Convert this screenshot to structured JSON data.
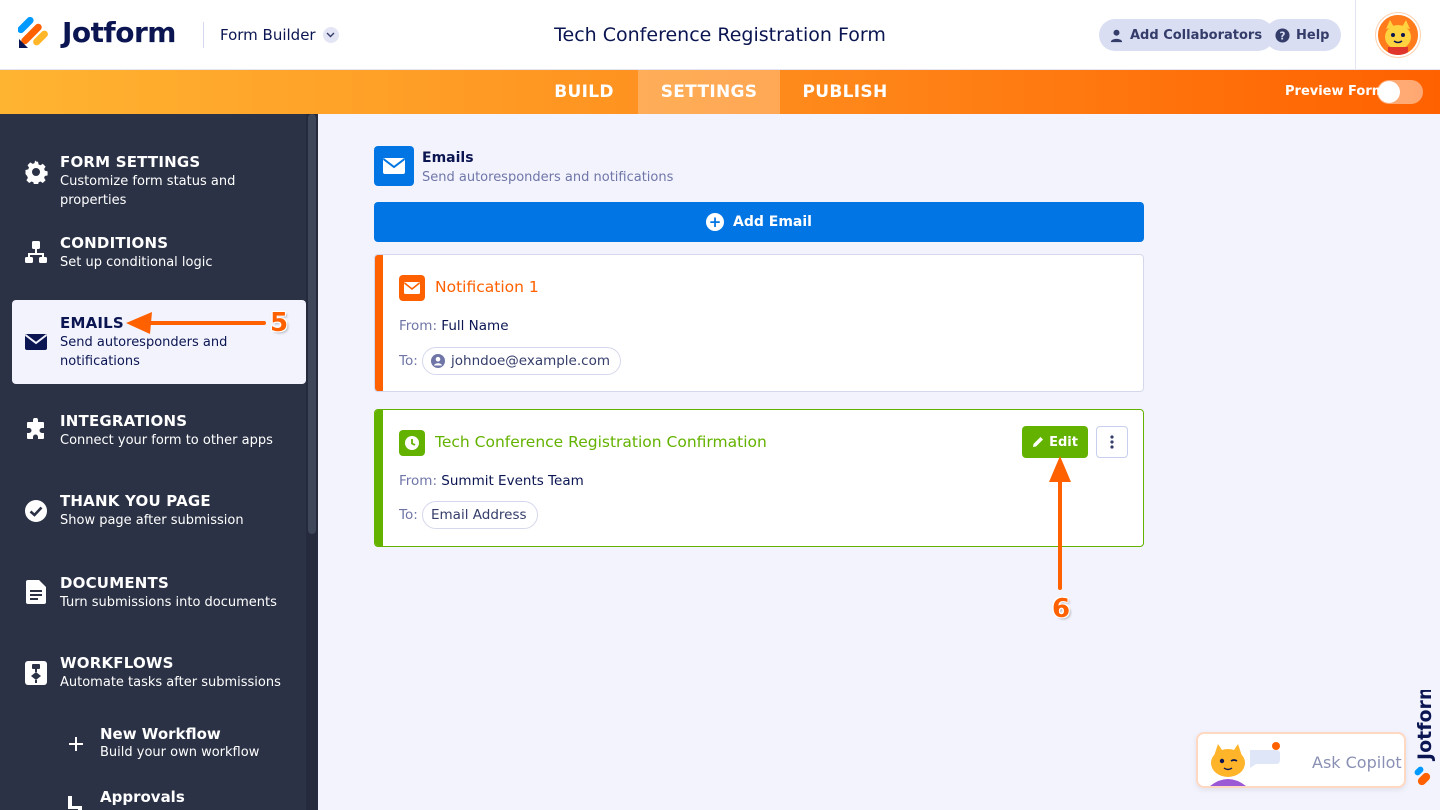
{
  "header": {
    "logo_text": "Jotform",
    "builder_select": "Form Builder",
    "form_title": "Tech Conference Registration Form",
    "add_collaborators": "Add Collaborators",
    "help": "Help"
  },
  "nav": {
    "tabs": [
      {
        "label": "BUILD",
        "active": false
      },
      {
        "label": "SETTINGS",
        "active": true
      },
      {
        "label": "PUBLISH",
        "active": false
      }
    ],
    "preview_label": "Preview Form",
    "preview_on": false
  },
  "sidebar": {
    "items": [
      {
        "title": "FORM SETTINGS",
        "desc": "Customize form status and properties",
        "icon": "gear-icon"
      },
      {
        "title": "CONDITIONS",
        "desc": "Set up conditional logic",
        "icon": "conditions-icon"
      },
      {
        "title": "EMAILS",
        "desc": "Send autoresponders and notifications",
        "icon": "envelope-icon",
        "active": true
      },
      {
        "title": "INTEGRATIONS",
        "desc": "Connect your form to other apps",
        "icon": "puzzle-icon"
      },
      {
        "title": "THANK YOU PAGE",
        "desc": "Show page after submission",
        "icon": "check-circle-icon"
      },
      {
        "title": "DOCUMENTS",
        "desc": "Turn submissions into documents",
        "icon": "document-icon"
      },
      {
        "title": "WORKFLOWS",
        "desc": "Automate tasks after submissions",
        "icon": "workflow-icon"
      }
    ],
    "sub_items": [
      {
        "title": "New Workflow",
        "desc": "Build your own workflow",
        "icon": "plus-icon"
      },
      {
        "title": "Approvals",
        "icon": "approval-icon"
      }
    ]
  },
  "main": {
    "section_title": "Emails",
    "section_sub": "Send autoresponders and notifications",
    "add_email": "Add Email",
    "cards": [
      {
        "title": "Notification 1",
        "from_label": "From:",
        "from_value": "Full Name",
        "to_label": "To:",
        "to_value": "johndoe@example.com",
        "accent": "#ff6100"
      },
      {
        "title": "Tech Conference Registration Confirmation",
        "from_label": "From:",
        "from_value": "Summit Events Team",
        "to_label": "To:",
        "to_value": "Email Address",
        "accent": "#64b200",
        "edit_label": "Edit"
      }
    ]
  },
  "annotations": {
    "step_5": "5",
    "step_6": "6"
  },
  "copilot": {
    "label": "Ask Copilot"
  },
  "colors": {
    "accent_orange": "#ff6100",
    "accent_blue": "#0075e3",
    "accent_green": "#64b200",
    "sidebar_bg": "#2b3245"
  }
}
